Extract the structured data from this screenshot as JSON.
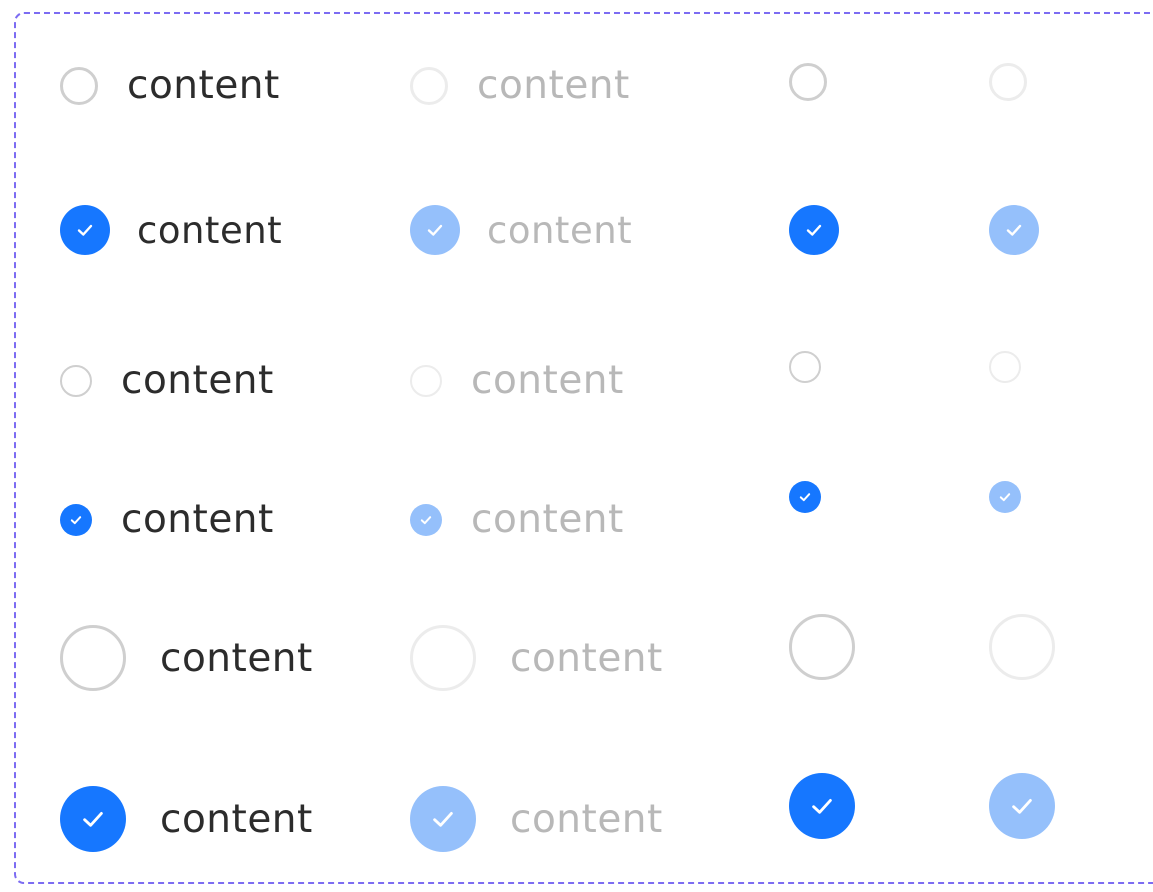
{
  "label": "content",
  "colors": {
    "checked": "#1677ff",
    "checked_disabled": "#95c0fb",
    "unchecked_border": "#cfcfcf",
    "unchecked_disabled_border": "#ececec",
    "text": "#2c2c2c",
    "text_disabled": "#b8b8b8",
    "frame_border": "#7c6cf2"
  },
  "icon": "check-icon"
}
